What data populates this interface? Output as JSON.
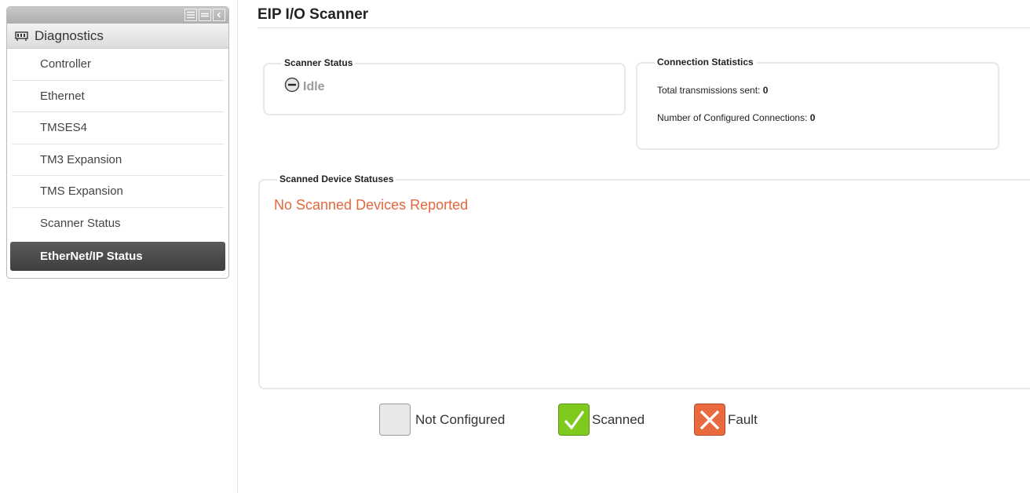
{
  "sidebar": {
    "header": "Diagnostics",
    "items": [
      {
        "label": "Controller"
      },
      {
        "label": "Ethernet"
      },
      {
        "label": "TMSES4"
      },
      {
        "label": "TM3 Expansion"
      },
      {
        "label": "TMS Expansion"
      },
      {
        "label": "Scanner Status"
      },
      {
        "label": "EtherNet/IP Status",
        "active": true
      }
    ],
    "toolbar_icons": [
      "expand-all-icon",
      "collapse-all-icon",
      "collapse-sidebar-icon"
    ]
  },
  "page": {
    "title": "EIP I/O Scanner"
  },
  "scanner_status": {
    "legend": "Scanner Status",
    "state": "Idle",
    "state_icon": "minus-circle-icon"
  },
  "connection_statistics": {
    "legend": "Connection Statistics",
    "total_label": "Total transmissions sent:",
    "total_value": "0",
    "configured_label": "Number of Configured Connections:",
    "configured_value": "0"
  },
  "scanned_devices": {
    "legend": "Scanned Device Statuses",
    "empty_message": "No Scanned Devices Reported"
  },
  "status_key": {
    "not_configured": "Not Configured",
    "scanned": "Scanned",
    "fault": "Fault"
  },
  "colors": {
    "empty_message": "#e4673d",
    "scanned": "#7fca1c",
    "fault": "#ea6a3f",
    "not_configured": "#e8e8e8",
    "active_item": "#4a4a4a"
  }
}
